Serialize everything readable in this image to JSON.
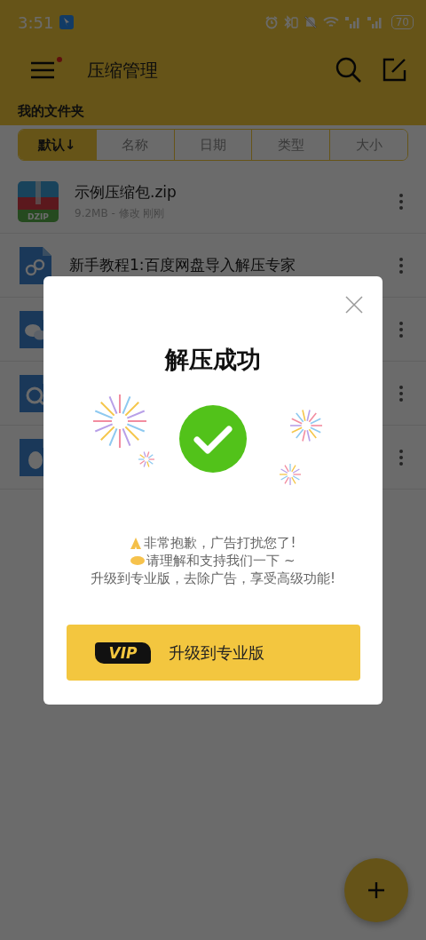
{
  "status_bar": {
    "time": "3:51",
    "battery": "70"
  },
  "app_bar": {
    "title": "压缩管理",
    "menu_badge": true
  },
  "section_title": "我的文件夹",
  "sort_tabs": [
    {
      "label": "默认↓",
      "selected": true
    },
    {
      "label": "名称",
      "selected": false
    },
    {
      "label": "日期",
      "selected": false
    },
    {
      "label": "类型",
      "selected": false
    },
    {
      "label": "大小",
      "selected": false
    }
  ],
  "files": [
    {
      "kind": "zip",
      "label": "DZIP",
      "name": "示例压缩包.zip",
      "meta": "9.2MB - 修改 刚刚"
    },
    {
      "kind": "link",
      "name": "新手教程1:百度网盘导入解压专家"
    },
    {
      "kind": "chat"
    },
    {
      "kind": "search"
    },
    {
      "kind": "penguin"
    }
  ],
  "dialog": {
    "title": "解压成功",
    "lines": [
      "非常抱歉，广告打扰您了!",
      "请理解和支持我们一下 ~",
      "升级到专业版，去除广告，享受高级功能!"
    ],
    "badge": "VIP",
    "button": "升级到专业版"
  }
}
